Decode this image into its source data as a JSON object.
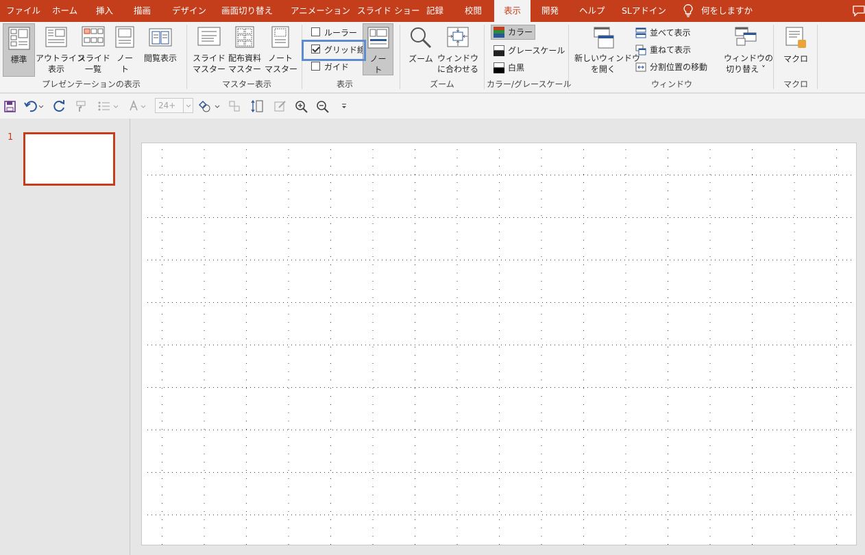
{
  "tabs": [
    {
      "label": "ファイル",
      "active": false
    },
    {
      "label": "ホーム",
      "active": false
    },
    {
      "label": "挿入",
      "active": false
    },
    {
      "label": "描画",
      "active": false
    },
    {
      "label": "デザイン",
      "active": false
    },
    {
      "label": "画面切り替え",
      "active": false
    },
    {
      "label": "アニメーション",
      "active": false
    },
    {
      "label": "スライド ショー",
      "active": false
    },
    {
      "label": "記録",
      "active": false
    },
    {
      "label": "校閲",
      "active": false
    },
    {
      "label": "表示",
      "active": true
    },
    {
      "label": "開発",
      "active": false
    },
    {
      "label": "ヘルプ",
      "active": false
    },
    {
      "label": "SLアドイン",
      "active": false
    }
  ],
  "tell_me": "何をしますか",
  "ribbon": {
    "presentation_views": {
      "label": "プレゼンテーションの表示",
      "normal": "標準",
      "outline_1": "アウトライン",
      "outline_2": "表示",
      "sorter_1": "スライド",
      "sorter_2": "一覧",
      "notes_1": "ノー",
      "notes_2": "ト",
      "reading": "閲覧表示"
    },
    "master_views": {
      "label": "マスター表示",
      "slide_master_1": "スライド",
      "slide_master_2": "マスター",
      "handout_master_1": "配布資料",
      "handout_master_2": "マスター",
      "notes_master_1": "ノート",
      "notes_master_2": "マスター"
    },
    "show": {
      "label": "表示",
      "ruler": "ルーラー",
      "gridlines": "グリッド線",
      "guides": "ガイド",
      "ruler_checked": false,
      "gridlines_checked": true,
      "guides_checked": false,
      "notes_1": "ノー",
      "notes_2": "ト"
    },
    "zoom": {
      "label": "ズーム",
      "zoom": "ズーム",
      "fit_1": "ウィンドウ",
      "fit_2": "に合わせる"
    },
    "color": {
      "label": "カラー/グレースケール",
      "color": "カラー",
      "grayscale": "グレースケール",
      "bw": "白黒"
    },
    "window": {
      "label": "ウィンドウ",
      "new_window_1": "新しいウィンドウ",
      "new_window_2": "を開く",
      "arrange_all": "並べて表示",
      "cascade": "重ねて表示",
      "move_split": "分割位置の移動",
      "switch_1": "ウィンドウの",
      "switch_2": "切り替え"
    },
    "macros": {
      "label": "マクロ",
      "macros": "マクロ"
    }
  },
  "qat": {
    "font_size": "24+"
  },
  "slides": [
    {
      "number": "1"
    }
  ],
  "colors": {
    "accent": "#c43e1c",
    "ribbon_bg": "#f3f3f3",
    "highlight": "#5b8bd0",
    "workspace": "#e6e6e6"
  }
}
